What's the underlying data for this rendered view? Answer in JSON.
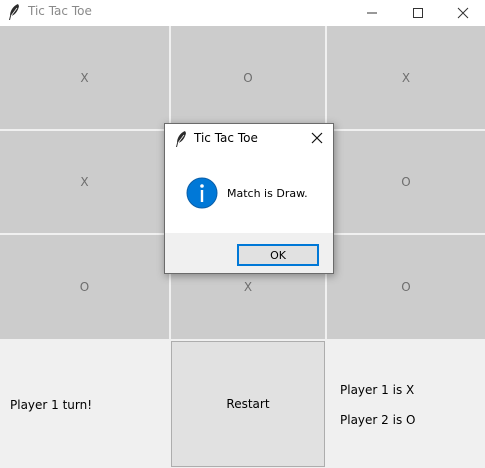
{
  "window": {
    "title": "Tic Tac Toe"
  },
  "board": {
    "cells": [
      "X",
      "O",
      "X",
      "X",
      "",
      "O",
      "O",
      "X",
      "O"
    ]
  },
  "status": {
    "turn_label": "Player 1 turn!",
    "restart_label": "Restart",
    "player1_label": "Player 1 is X",
    "player2_label": "Player 2 is O"
  },
  "dialog": {
    "title": "Tic Tac Toe",
    "message": "Match is Draw.",
    "ok_label": "OK"
  },
  "colors": {
    "cell_bg": "#cccccc",
    "dialog_button_border": "#0078d7",
    "info_icon": "#0078d7"
  },
  "icons": {
    "app": "feather-icon",
    "info": "info-icon"
  }
}
